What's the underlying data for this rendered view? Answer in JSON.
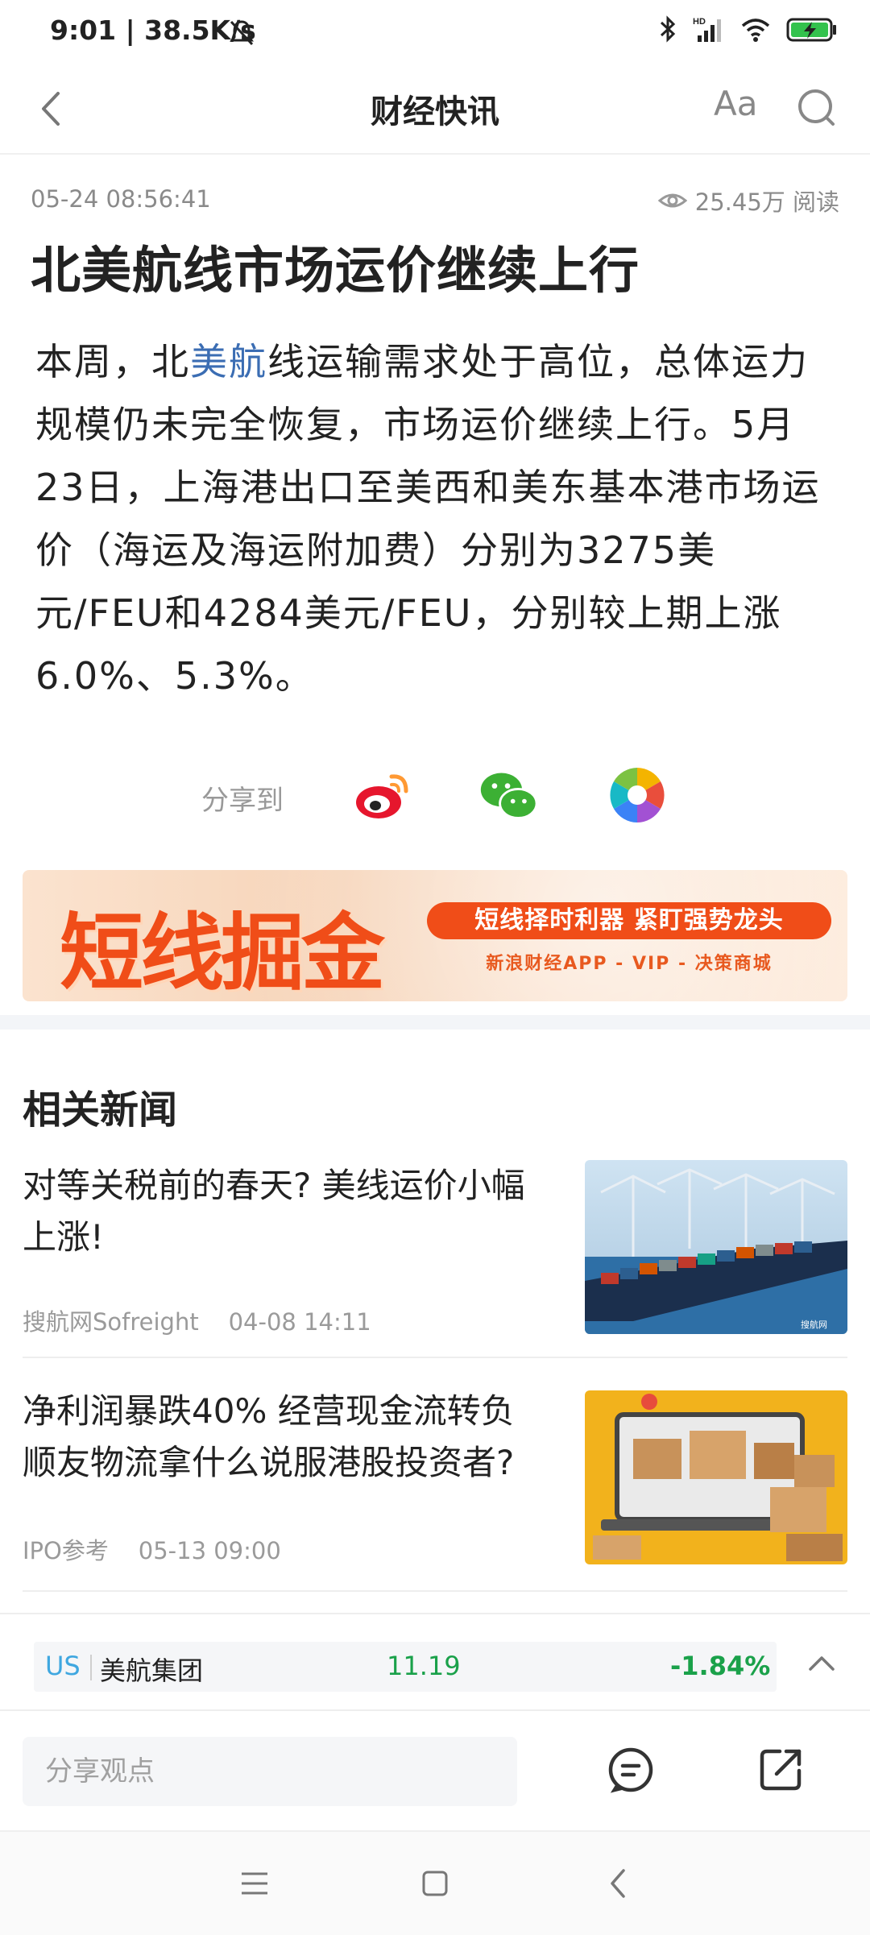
{
  "status_bar": {
    "time": "9:01 | 38.5K/s",
    "icons": [
      "silent-icon",
      "bluetooth-icon",
      "hd-signal-icon",
      "wifi-icon",
      "battery-charging-icon"
    ]
  },
  "header": {
    "title": "财经快讯",
    "back_icon": "chevron-left-icon",
    "font_label": "Aa",
    "search_icon": "search-icon"
  },
  "article": {
    "time": "05-24 08:56:41",
    "read_count": "25.45万 阅读",
    "title": "北美航线市场运价继续上行",
    "body_pre": "本周，北",
    "body_link": "美航",
    "body_post": "线运输需求处于高位，总体运力规模仍未完全恢复，市场运价继续上行。5月23日，上海港出口至美西和美东基本港市场运价（海运及海运附加费）分别为3275美元/FEU和4284美元/FEU，分别较上期上涨6.0%、5.3%。"
  },
  "share": {
    "label": "分享到",
    "targets": [
      "weibo-icon",
      "wechat-icon",
      "moments-icon"
    ]
  },
  "banner": {
    "headline": "短线掘金",
    "pill": "短线择时利器  紧盯强势龙头",
    "sub": "新浪财经APP - VIP - 决策商城"
  },
  "related": {
    "heading": "相关新闻",
    "items": [
      {
        "title": "对等关税前的春天? 美线运价小幅上涨!",
        "source": "搜航网Sofreight",
        "time": "04-08 14:11",
        "thumb_label": "搜航网"
      },
      {
        "title": "净利润暴跌40% 经营现金流转负 顺友物流拿什么说服港股投资者?",
        "source": "IPO参考",
        "time": "05-13 09:00"
      }
    ]
  },
  "stock": {
    "market": "US",
    "name": "美航集团",
    "price": "11.19",
    "change": "-1.84%",
    "color_down": "#1aa14a"
  },
  "comment": {
    "placeholder": "分享观点"
  },
  "nav": [
    "menu-icon",
    "home-icon",
    "back-icon"
  ]
}
